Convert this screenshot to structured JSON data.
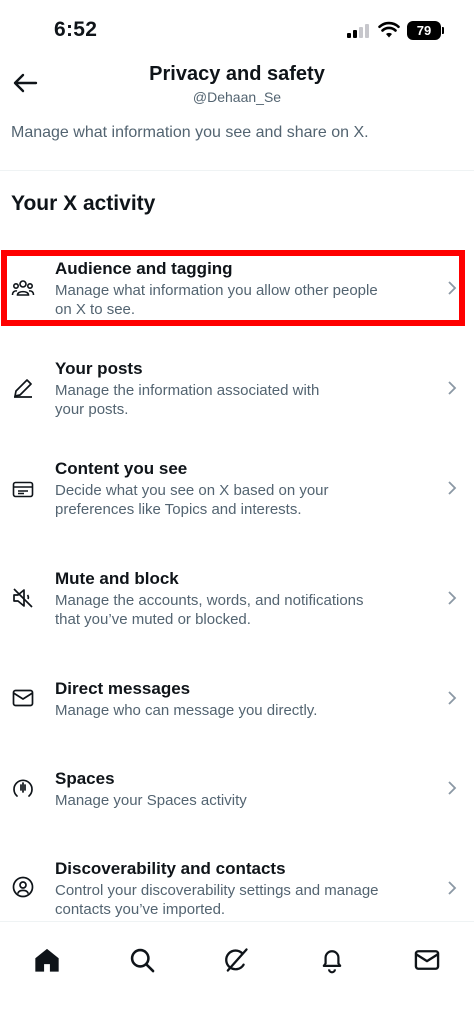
{
  "status_bar": {
    "time": "6:52",
    "battery": "79"
  },
  "header": {
    "title": "Privacy and safety",
    "username": "@Dehaan_Se"
  },
  "intro": "Manage what information you see and share on X.",
  "section": {
    "title": "Your X activity"
  },
  "items": [
    {
      "title": "Audience and tagging",
      "desc_line1": "Manage what information you allow other people",
      "desc_line2": "on X to see.",
      "icon": "people-icon"
    },
    {
      "title": "Your posts",
      "desc_line1": "Manage the information associated with",
      "desc_line2": "your posts.",
      "icon": "pencil-icon"
    },
    {
      "title": "Content you see",
      "desc_line1": "Decide what you see on X based on your",
      "desc_line2": "preferences like Topics and interests.",
      "icon": "content-icon"
    },
    {
      "title": "Mute and block",
      "desc_line1": "Manage the accounts, words, and notifications",
      "desc_line2": "that you’ve muted or blocked.",
      "icon": "mute-icon"
    },
    {
      "title": "Direct messages",
      "desc_line1": "Manage who can message you directly.",
      "desc_line2": "",
      "icon": "envelope-icon"
    },
    {
      "title": "Spaces",
      "desc_line1": "Manage your Spaces activity",
      "desc_line2": "",
      "icon": "spaces-icon"
    },
    {
      "title": "Discoverability and contacts",
      "desc_line1": "Control your discoverability settings and manage",
      "desc_line2": "contacts you’ve imported.",
      "icon": "discover-icon"
    }
  ],
  "tabbar": [
    "home-icon",
    "search-icon",
    "grok-icon",
    "notifications-icon",
    "messages-icon"
  ],
  "colors": {
    "highlight": "#ff0000",
    "text": "#0f1419",
    "secondary": "#536471"
  }
}
